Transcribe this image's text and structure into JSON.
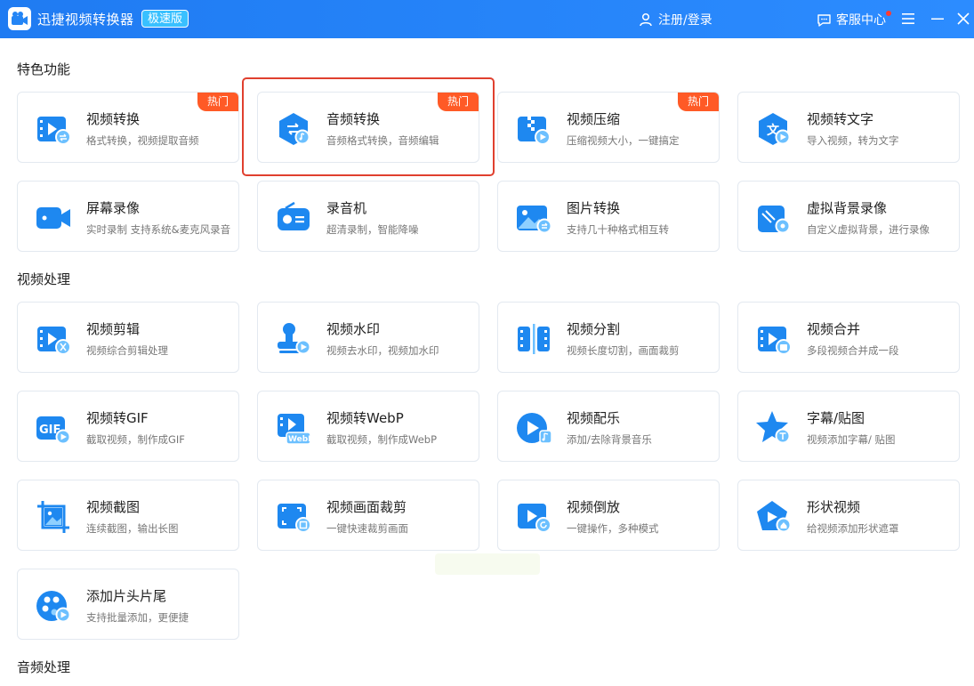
{
  "titlebar": {
    "app_title": "迅捷视频转换器",
    "edition": "极速版",
    "login": "注册/登录",
    "service": "客服中心"
  },
  "sections": {
    "special": "特色功能",
    "video": "视频处理",
    "audio": "音频处理"
  },
  "hot_label": "热门",
  "cards": [
    {
      "title": "视频转换",
      "desc": "格式转换，视频提取音频",
      "icon": "video-convert-icon"
    },
    {
      "title": "音频转换",
      "desc": "音频格式转换，音频编辑",
      "icon": "audio-convert-icon"
    },
    {
      "title": "视频压缩",
      "desc": "压缩视频大小，一键搞定",
      "icon": "video-compress-icon"
    },
    {
      "title": "视频转文字",
      "desc": "导入视频，转为文字",
      "icon": "video-to-text-icon"
    },
    {
      "title": "屏幕录像",
      "desc": "实时录制 支持系统&麦克风录音",
      "icon": "screen-record-icon"
    },
    {
      "title": "录音机",
      "desc": "超清录制，智能降噪",
      "icon": "recorder-icon"
    },
    {
      "title": "图片转换",
      "desc": "支持几十种格式相互转",
      "icon": "image-convert-icon"
    },
    {
      "title": "虚拟背景录像",
      "desc": "自定义虚拟背景，进行录像",
      "icon": "virtual-bg-icon"
    },
    {
      "title": "视频剪辑",
      "desc": "视频综合剪辑处理",
      "icon": "video-edit-icon"
    },
    {
      "title": "视频水印",
      "desc": "视频去水印，视频加水印",
      "icon": "watermark-icon"
    },
    {
      "title": "视频分割",
      "desc": "视频长度切割，画面裁剪",
      "icon": "video-split-icon"
    },
    {
      "title": "视频合并",
      "desc": "多段视频合并成一段",
      "icon": "video-merge-icon"
    },
    {
      "title": "视频转GIF",
      "desc": "截取视频，制作成GIF",
      "icon": "gif-icon"
    },
    {
      "title": "视频转WebP",
      "desc": "截取视频，制作成WebP",
      "icon": "webp-icon"
    },
    {
      "title": "视频配乐",
      "desc": "添加/去除背景音乐",
      "icon": "music-icon"
    },
    {
      "title": "字幕/贴图",
      "desc": "视频添加字幕/ 贴图",
      "icon": "subtitle-icon"
    },
    {
      "title": "视频截图",
      "desc": "连续截图，输出长图",
      "icon": "screenshot-icon"
    },
    {
      "title": "视频画面裁剪",
      "desc": "一键快速裁剪画面",
      "icon": "crop-icon"
    },
    {
      "title": "视频倒放",
      "desc": "一键操作，多种模式",
      "icon": "reverse-icon"
    },
    {
      "title": "形状视频",
      "desc": "给视频添加形状遮罩",
      "icon": "shape-video-icon"
    },
    {
      "title": "添加片头片尾",
      "desc": "支持批量添加，更便捷",
      "icon": "intro-outro-icon"
    }
  ],
  "icon_text": {
    "gif": "GIF",
    "webp": "WebP",
    "text": "文"
  },
  "colors": {
    "titlebar": "#2485f5",
    "accent": "#1e88f0",
    "hot": "#ff5a26",
    "highlight": "#e0402f"
  }
}
